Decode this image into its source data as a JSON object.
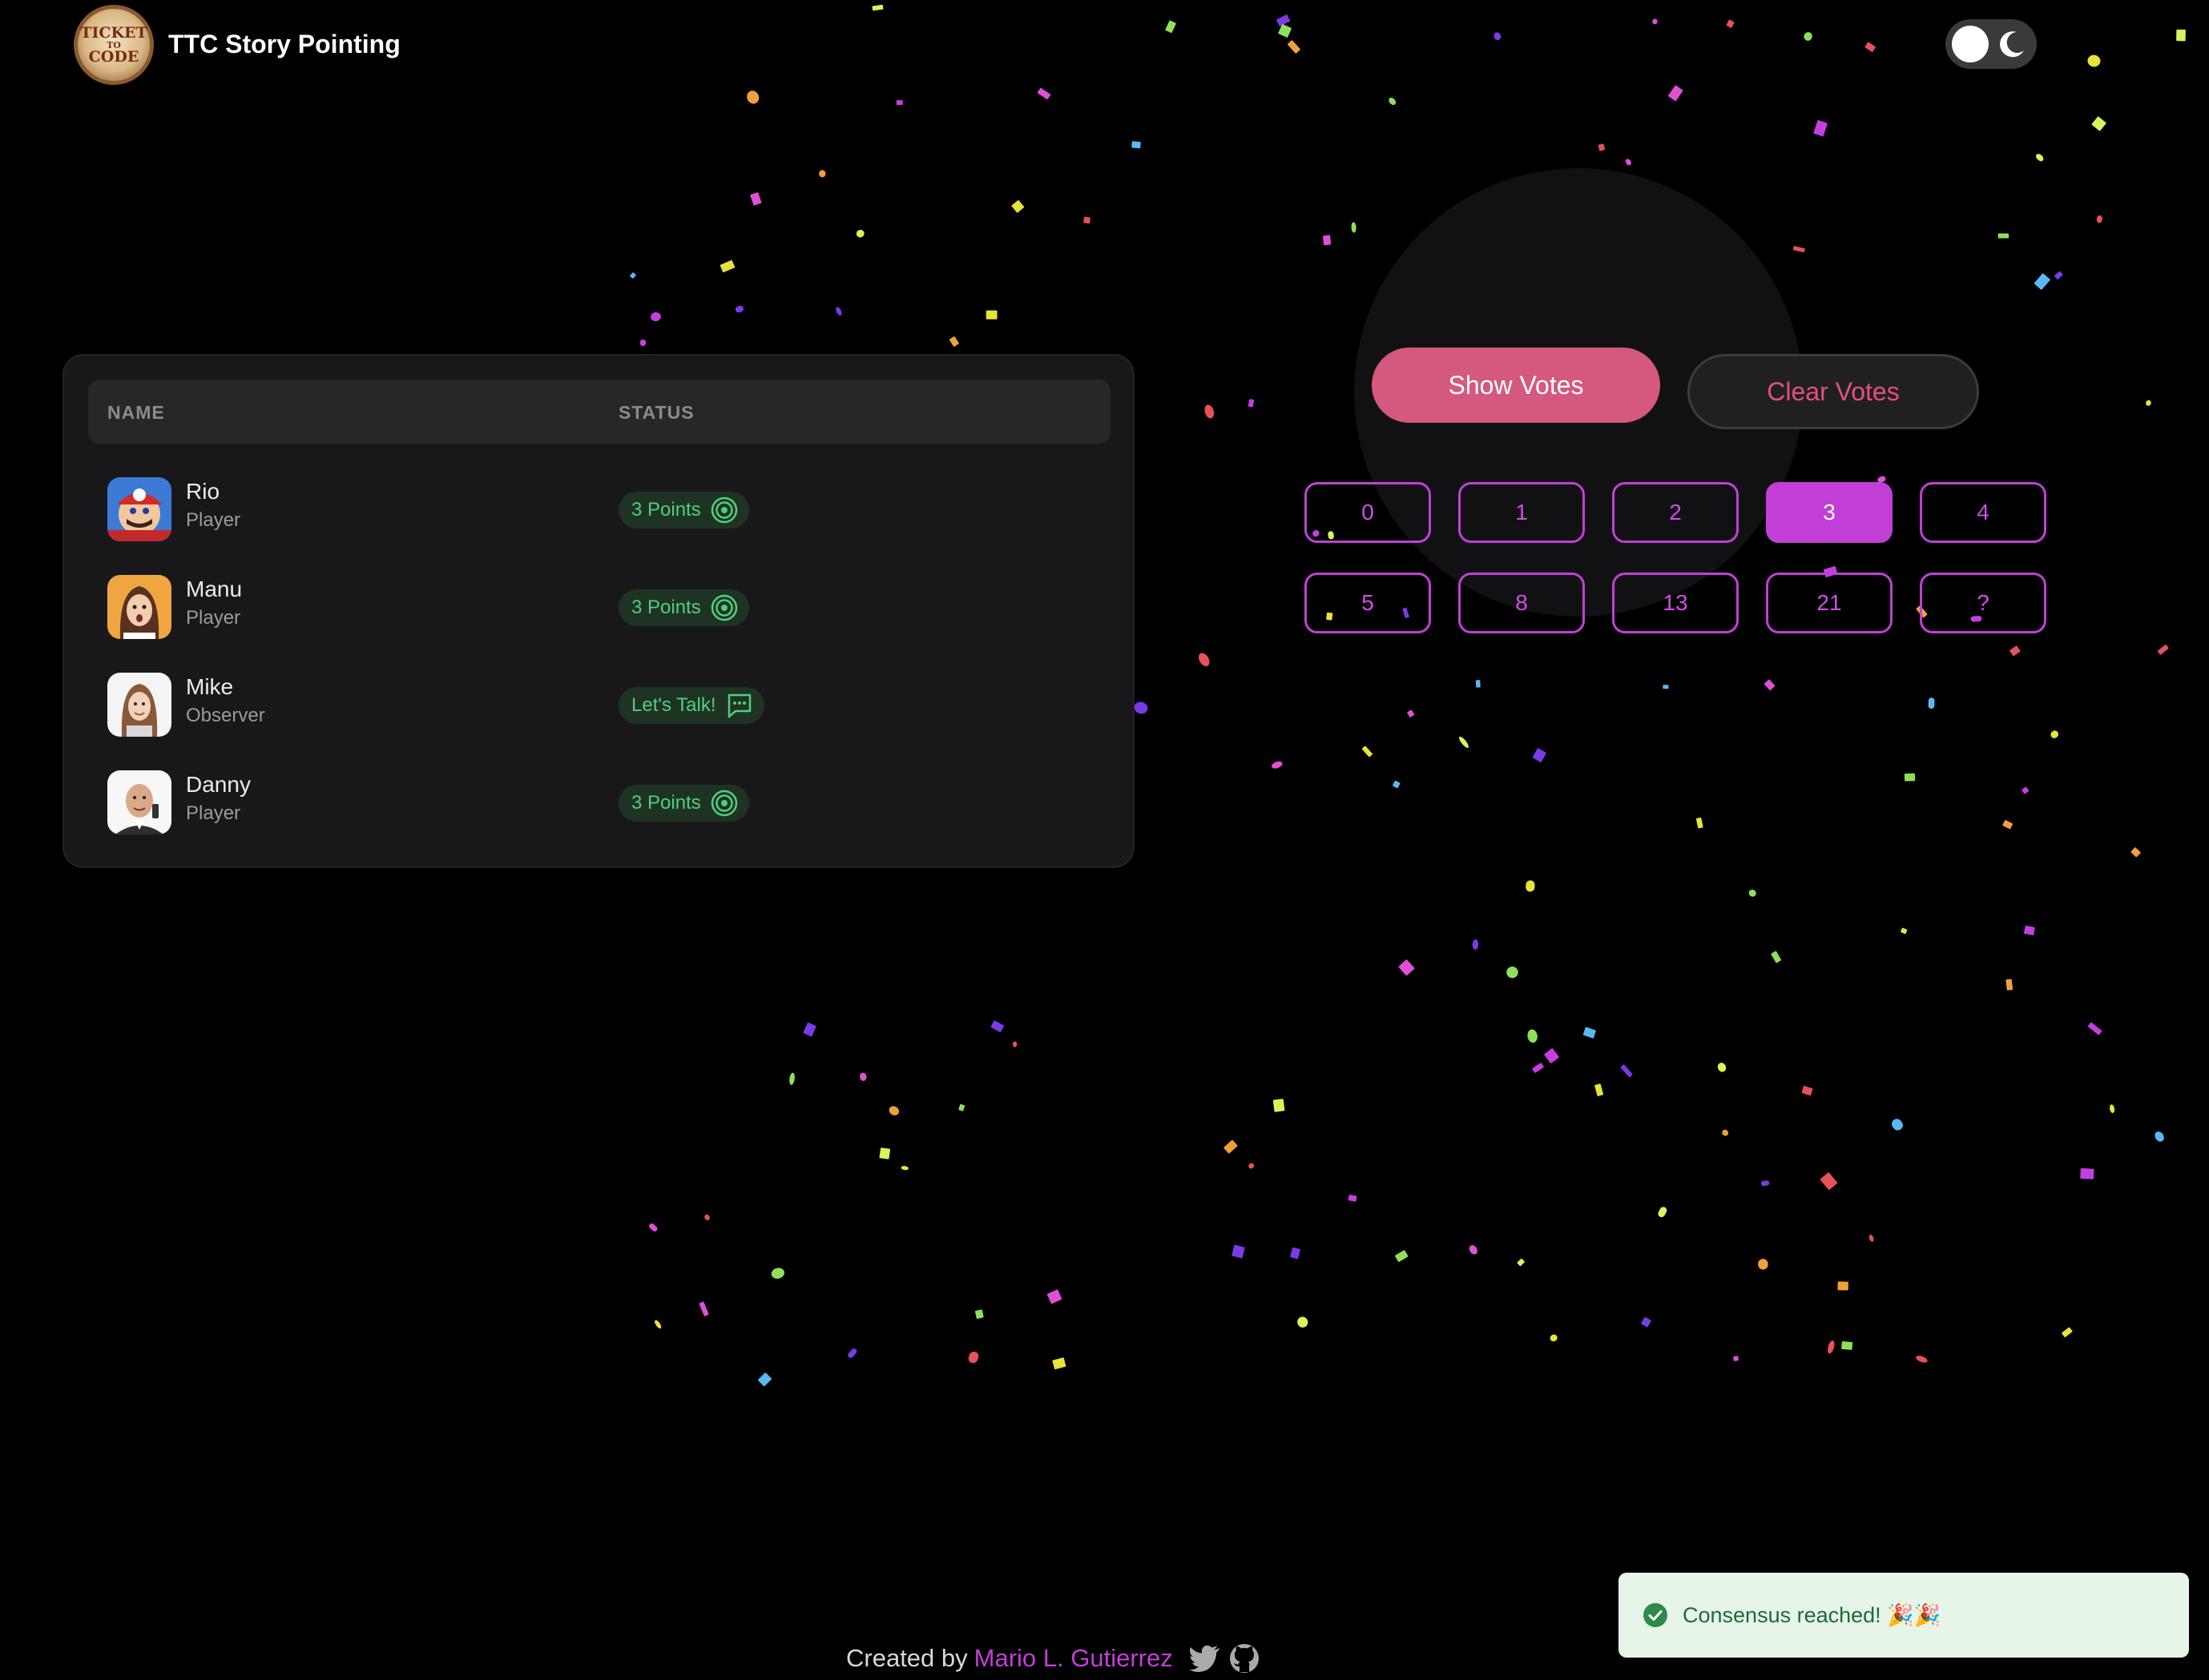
{
  "header": {
    "app_title": "TTC Story Pointing",
    "logo_text": [
      "TICKET",
      "TO",
      "CODE"
    ],
    "theme_toggle": {
      "mode": "dark"
    }
  },
  "participants": {
    "columns": [
      "NAME",
      "STATUS"
    ],
    "rows": [
      {
        "name": "Rio",
        "role": "Player",
        "status": "3 Points",
        "status_icon": "target-icon"
      },
      {
        "name": "Manu",
        "role": "Player",
        "status": "3 Points",
        "status_icon": "target-icon"
      },
      {
        "name": "Mike",
        "role": "Observer",
        "status": "Let's Talk!",
        "status_icon": "chat-icon"
      },
      {
        "name": "Danny",
        "role": "Player",
        "status": "3 Points",
        "status_icon": "target-icon"
      }
    ]
  },
  "actions": {
    "show_votes": "Show Votes",
    "clear_votes": "Clear Votes"
  },
  "vote_options": [
    "0",
    "1",
    "2",
    "3",
    "4",
    "5",
    "8",
    "13",
    "21",
    "?"
  ],
  "selected_vote": "3",
  "toast": {
    "message": "Consensus reached! 🎉🎉",
    "icon": "check-circle-icon"
  },
  "footer": {
    "prefix": "Created by",
    "author": "Mario L. Gutierrez",
    "icons": [
      "twitter-icon",
      "github-icon"
    ]
  },
  "colors": {
    "accent_purple": "#c13fd6",
    "pink_button": "#d5587e",
    "chip_green": "#4ed07a",
    "background": "#000000"
  }
}
